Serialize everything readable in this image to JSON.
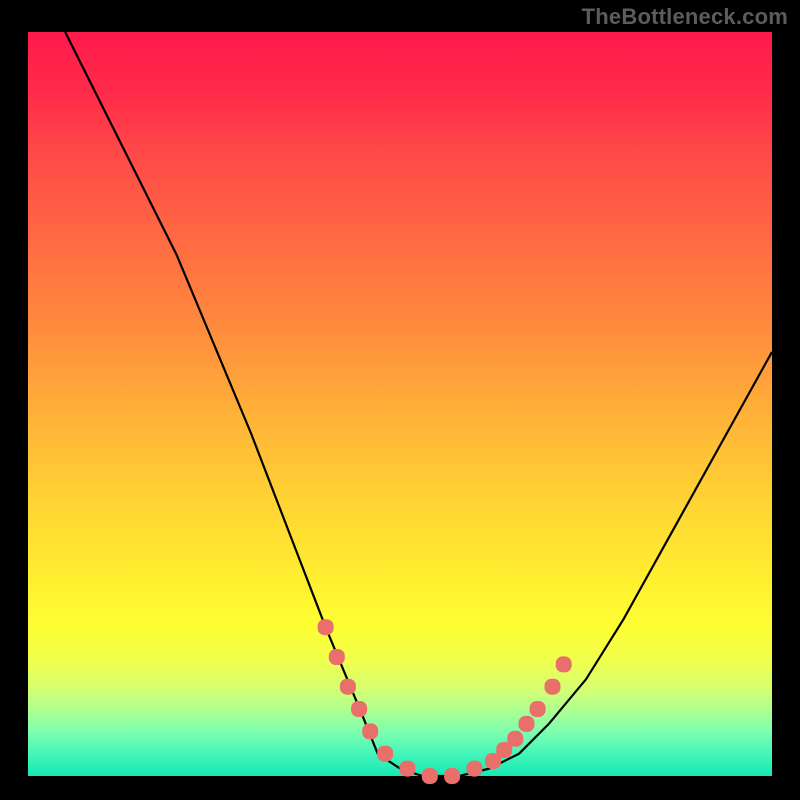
{
  "watermark": "TheBottleneck.com",
  "colors": {
    "background": "#000000",
    "gradient_top": "#ff1a4b",
    "gradient_mid": "#ffd633",
    "gradient_bottom": "#15e8b6",
    "curve": "#000000",
    "marker": "#e86f6a"
  },
  "chart_data": {
    "type": "line",
    "title": "",
    "xlabel": "",
    "ylabel": "",
    "xlim": [
      0,
      100
    ],
    "ylim": [
      0,
      100
    ],
    "x": [
      5,
      10,
      15,
      20,
      25,
      30,
      35,
      40,
      45,
      47,
      50,
      53,
      55,
      58,
      62,
      66,
      70,
      75,
      80,
      85,
      90,
      95,
      100
    ],
    "y": [
      100,
      90,
      80,
      70,
      58,
      46,
      33,
      20,
      8,
      3,
      1,
      0,
      0,
      0,
      1,
      3,
      7,
      13,
      21,
      30,
      39,
      48,
      57
    ],
    "series": [
      {
        "name": "markers",
        "x": [
          40,
          41.5,
          43,
          44.5,
          46,
          48,
          51,
          54,
          57,
          60,
          62.5,
          64,
          65.5,
          67,
          68.5,
          70.5,
          72
        ],
        "y": [
          20,
          16,
          12,
          9,
          6,
          3,
          1,
          0,
          0,
          1,
          2,
          3.5,
          5,
          7,
          9,
          12,
          15
        ]
      }
    ]
  }
}
